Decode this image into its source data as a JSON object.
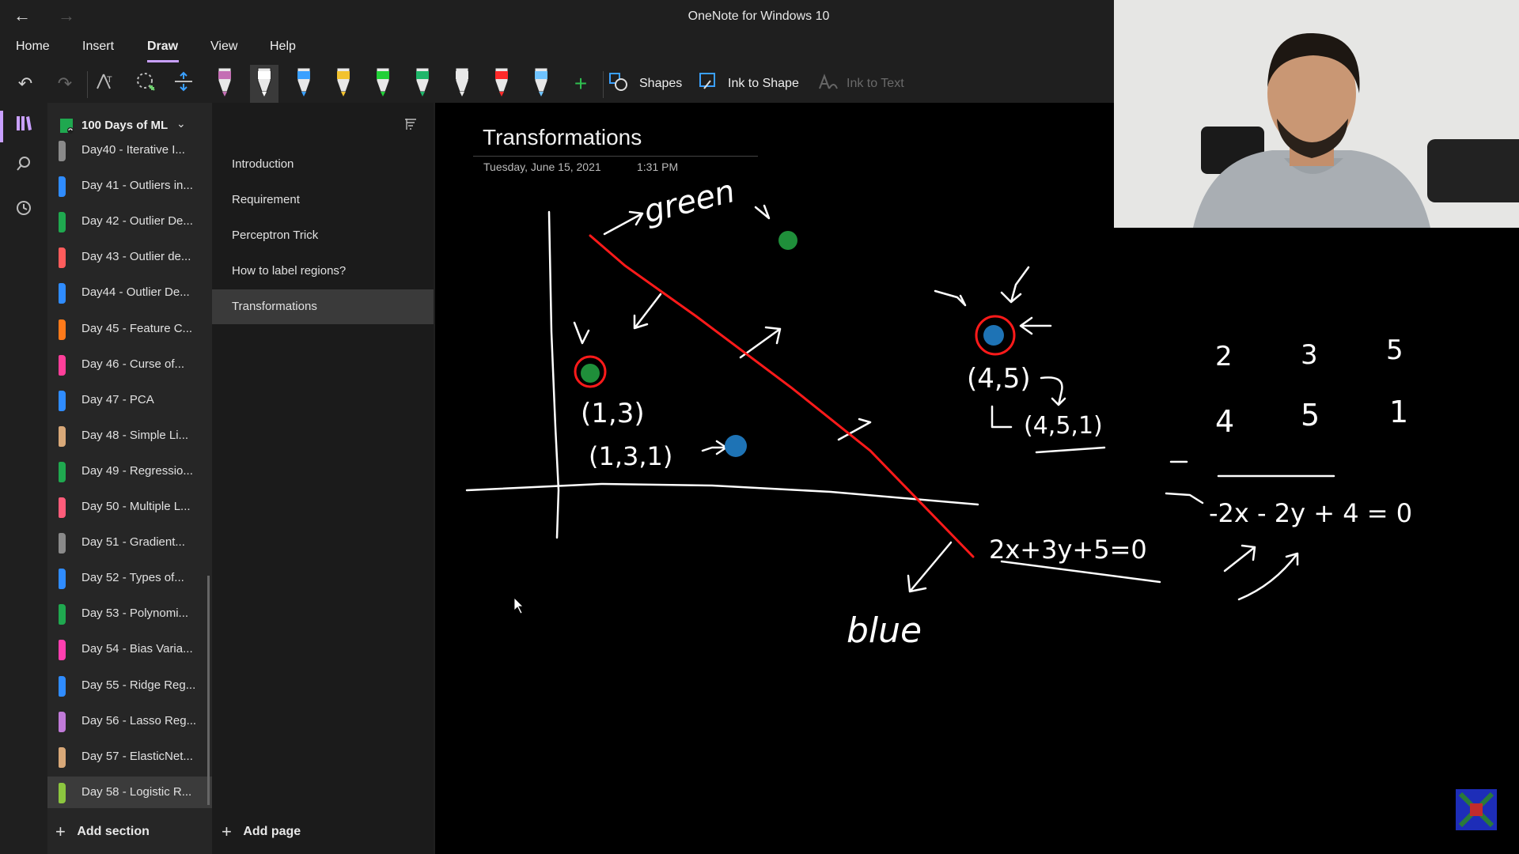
{
  "window": {
    "title": "OneNote for Windows 10"
  },
  "menu": [
    "Home",
    "Insert",
    "Draw",
    "View",
    "Help"
  ],
  "menu_active": "Draw",
  "toolbar": {
    "shapes_label": "Shapes",
    "ink_to_shape_label": "Ink to Shape",
    "ink_to_text_label": "Ink to Text",
    "pens": [
      {
        "name": "eraser-pen",
        "color": "#c46fb4"
      },
      {
        "name": "white-pen",
        "color": "#ffffff"
      },
      {
        "name": "blue-pen",
        "color": "#3aa0ff"
      },
      {
        "name": "yellow-pen",
        "color": "#f2c230"
      },
      {
        "name": "green-highlighter",
        "color": "#22d038"
      },
      {
        "name": "green-pen",
        "color": "#1fb56a"
      },
      {
        "name": "white-pen-2",
        "color": "#e8e8e8"
      },
      {
        "name": "red-pen",
        "color": "#ff2a2a"
      },
      {
        "name": "lightblue-pen",
        "color": "#6fc3ff"
      }
    ]
  },
  "notebook": {
    "name": "100 Days of ML"
  },
  "sections": [
    {
      "label": "Day40 - Iterative I...",
      "color": "#8a8a8a"
    },
    {
      "label": "Day 41 - Outliers in...",
      "color": "#2f8cff"
    },
    {
      "label": "Day 42 - Outlier De...",
      "color": "#1fa84f"
    },
    {
      "label": "Day 43 - Outlier de...",
      "color": "#ff5c5c"
    },
    {
      "label": "Day44 - Outlier De...",
      "color": "#2f8cff"
    },
    {
      "label": "Day 45 - Feature C...",
      "color": "#ff7a1a"
    },
    {
      "label": "Day 46 - Curse of...",
      "color": "#ff3f9a"
    },
    {
      "label": "Day 47 - PCA",
      "color": "#2f8cff"
    },
    {
      "label": "Day 48 - Simple Li...",
      "color": "#d8a878"
    },
    {
      "label": "Day 49 - Regressio...",
      "color": "#1fa84f"
    },
    {
      "label": "Day 50 - Multiple L...",
      "color": "#ff5c7a"
    },
    {
      "label": "Day 51 - Gradient...",
      "color": "#8a8a8a"
    },
    {
      "label": "Day 52 - Types of...",
      "color": "#2f8cff"
    },
    {
      "label": "Day 53 - Polynomi...",
      "color": "#1fa84f"
    },
    {
      "label": "Day 54 - Bias Varia...",
      "color": "#ff3fb0"
    },
    {
      "label": "Day 55 - Ridge Reg...",
      "color": "#2f8cff"
    },
    {
      "label": "Day 56 - Lasso Reg...",
      "color": "#c07ad8"
    },
    {
      "label": "Day 57 - ElasticNet...",
      "color": "#d8a878"
    },
    {
      "label": "Day 58 - Logistic R...",
      "color": "#8cc63f"
    }
  ],
  "selected_section": 18,
  "pages": [
    "Introduction",
    "Requirement",
    "Perceptron Trick",
    "How to label regions?",
    "Transformations"
  ],
  "selected_page": 4,
  "add_section_label": "Add section",
  "add_page_label": "Add page",
  "page": {
    "title": "Transformations",
    "date": "Tuesday, June 15, 2021",
    "time": "1:31 PM"
  },
  "ink": {
    "label_green": "green",
    "label_blue": "blue",
    "point_a": "(1,3)",
    "point_a_ext": "(1,3,1)",
    "point_b": "(4,5)",
    "point_b_ext": "(4,5,1)",
    "equation": "2x+3y+5=0",
    "row1": [
      "2",
      "3",
      "5"
    ],
    "row2": [
      "4",
      "5",
      "1"
    ],
    "result": "-2x - 2y + 4 = 0",
    "minus": "-"
  }
}
